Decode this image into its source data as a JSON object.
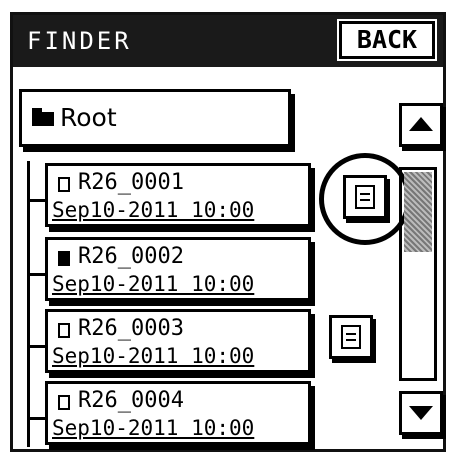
{
  "header": {
    "title": "FINDER",
    "back_label": "BACK"
  },
  "root": {
    "label": "Root",
    "icon": "folder-icon"
  },
  "files": [
    {
      "name": "R26_0001",
      "date": "Sep10-2011 10:00",
      "icon": "file-icon",
      "has_detail": true,
      "selected": true
    },
    {
      "name": "R26_0002",
      "date": "Sep10-2011 10:00",
      "icon": "file-locked-icon",
      "has_detail": false
    },
    {
      "name": "R26_0003",
      "date": "Sep10-2011 10:00",
      "icon": "file-icon",
      "has_detail": true
    },
    {
      "name": "R26_0004",
      "date": "Sep10-2011 10:00",
      "icon": "file-icon",
      "has_detail": false
    }
  ],
  "scrollbar": {
    "position_fraction": 0.0,
    "thumb_fraction": 0.38
  }
}
